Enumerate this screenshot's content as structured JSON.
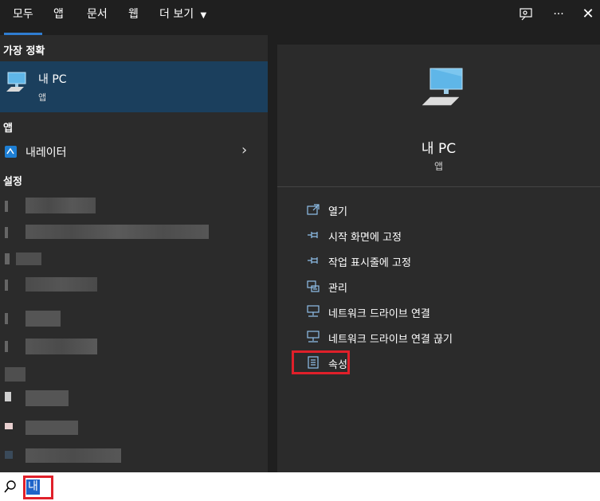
{
  "tabs": [
    {
      "label": "모두"
    },
    {
      "label": "앱"
    },
    {
      "label": "문서"
    },
    {
      "label": "웹"
    },
    {
      "label": "더 보기"
    }
  ],
  "left": {
    "best_match_header": "가장 정확",
    "best_match": {
      "title": "내 PC",
      "subtitle": "앱"
    },
    "apps_header": "앱",
    "app_item": {
      "label": "내레이터"
    },
    "settings_header": "설정"
  },
  "preview": {
    "title": "내 PC",
    "subtitle": "앱"
  },
  "actions": [
    {
      "label": "열기",
      "icon": "open-icon"
    },
    {
      "label": "시작 화면에 고정",
      "icon": "pin-icon"
    },
    {
      "label": "작업 표시줄에 고정",
      "icon": "pin-icon"
    },
    {
      "label": "관리",
      "icon": "manage-icon"
    },
    {
      "label": "네트워크 드라이브 연결",
      "icon": "network-drive-icon"
    },
    {
      "label": "네트워크 드라이브 연결 끊기",
      "icon": "network-drive-icon"
    },
    {
      "label": "속성",
      "icon": "properties-icon"
    }
  ],
  "search": {
    "value": "내"
  },
  "colors": {
    "accent": "#2f7dd1",
    "best_match_bg": "#1b3f5d",
    "highlight_box": "#e0202a"
  }
}
